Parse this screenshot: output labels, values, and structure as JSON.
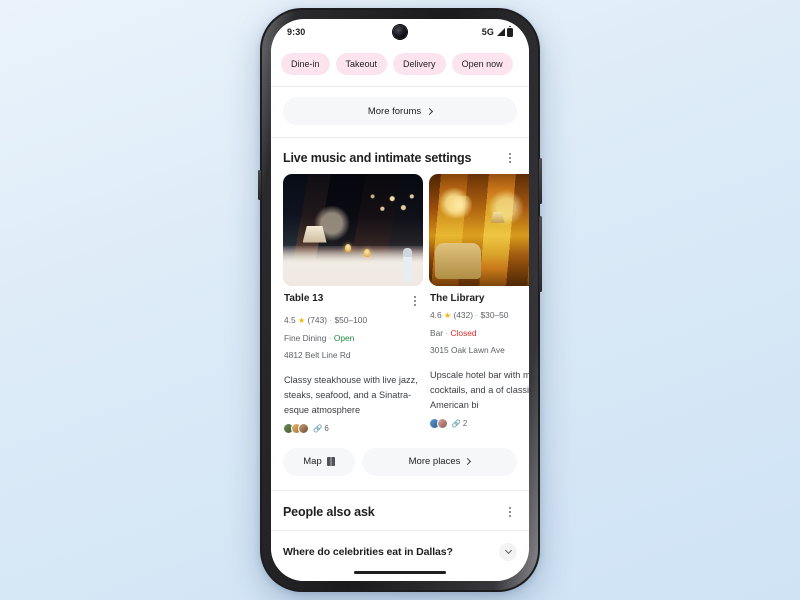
{
  "device": {
    "status_bar": {
      "time": "9:30",
      "network": "5G",
      "signal_icon": "signal-bars-icon",
      "battery_icon": "battery-icon",
      "camera_icon": "front-camera-punch-hole"
    },
    "home_indicator": "home-indicator"
  },
  "filters": {
    "chips": [
      {
        "label": "Dine-in"
      },
      {
        "label": "Takeout"
      },
      {
        "label": "Delivery"
      },
      {
        "label": "Open now"
      }
    ],
    "chip_color": "#fbe4ee"
  },
  "forums": {
    "more_forums_label": "More forums",
    "chevron_icon": "chevron-right-icon"
  },
  "places_section": {
    "title": "Live music and intimate settings",
    "overflow_icon": "kebab-menu-icon",
    "cards": [
      {
        "name": "Table 13",
        "rating": "4.5",
        "star_icon": "star-icon",
        "review_count": "(743)",
        "price_range": "$50–100",
        "category": "Fine Dining",
        "status": "Open",
        "status_color": "#1e8e3e",
        "address": "4812 Belt Line Rd",
        "description": "Classy steakhouse with live jazz, steaks, seafood, and a Sinatra-esque atmosphere",
        "source_count": "6",
        "link_icon": "link-icon",
        "overflow_icon": "kebab-menu-icon",
        "photo_alt": "dim-lit restaurant dining room with chandeliers"
      },
      {
        "name": "The Library",
        "rating": "4.6",
        "star_icon": "star-icon",
        "review_count": "(432)",
        "price_range": "$30–50",
        "category": "Bar",
        "status": "Closed",
        "status_color": "#d93025",
        "address": "3015 Oak Lawn Ave",
        "description": "Upscale hotel bar with music, cocktails, and a of classic American bi",
        "source_count": "2",
        "link_icon": "link-icon",
        "photo_alt": "warm golden upscale hotel bar interior"
      }
    ],
    "actions": {
      "map_label": "Map",
      "map_icon": "map-icon",
      "more_places_label": "More places",
      "chevron_icon": "chevron-right-icon"
    }
  },
  "people_also_ask": {
    "title": "People also ask",
    "overflow_icon": "kebab-menu-icon",
    "questions": [
      {
        "text": "Where do celebrities eat in Dallas?",
        "expand_icon": "chevron-down-icon"
      }
    ]
  }
}
